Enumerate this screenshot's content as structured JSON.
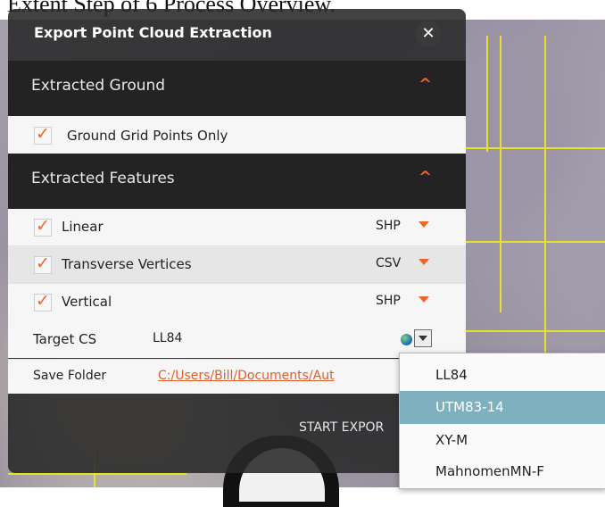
{
  "background_text": "Extent Step of 6 Process Overview.",
  "panel": {
    "title": "Export Point Cloud Extraction",
    "close_glyph": "✕",
    "extracted_ground": {
      "header": "Extracted Ground",
      "items": [
        {
          "label": "Ground Grid Points Only",
          "checked": true
        }
      ]
    },
    "extracted_features": {
      "header": "Extracted Features",
      "items": [
        {
          "label": "Linear",
          "checked": true,
          "format": "SHP"
        },
        {
          "label": "Transverse Vertices",
          "checked": true,
          "format": "CSV"
        },
        {
          "label": "Vertical",
          "checked": true,
          "format": "SHP"
        }
      ]
    },
    "target_cs": {
      "label": "Target CS",
      "value": "LL84"
    },
    "save_folder": {
      "label": "Save Folder",
      "value": "C:/Users/Bill/Documents/Aut"
    },
    "start_export_label": "START EXPOR"
  },
  "cs_menu": {
    "options": [
      "LL84",
      "UTM83-14",
      "XY-M",
      "MahnomenMN-F"
    ],
    "selected": "UTM83-14"
  },
  "colors": {
    "accent": "#f0642a",
    "panel_bg": "#282828",
    "menu_selected": "#7fb0c0",
    "map_grid": "#e8e12a"
  }
}
